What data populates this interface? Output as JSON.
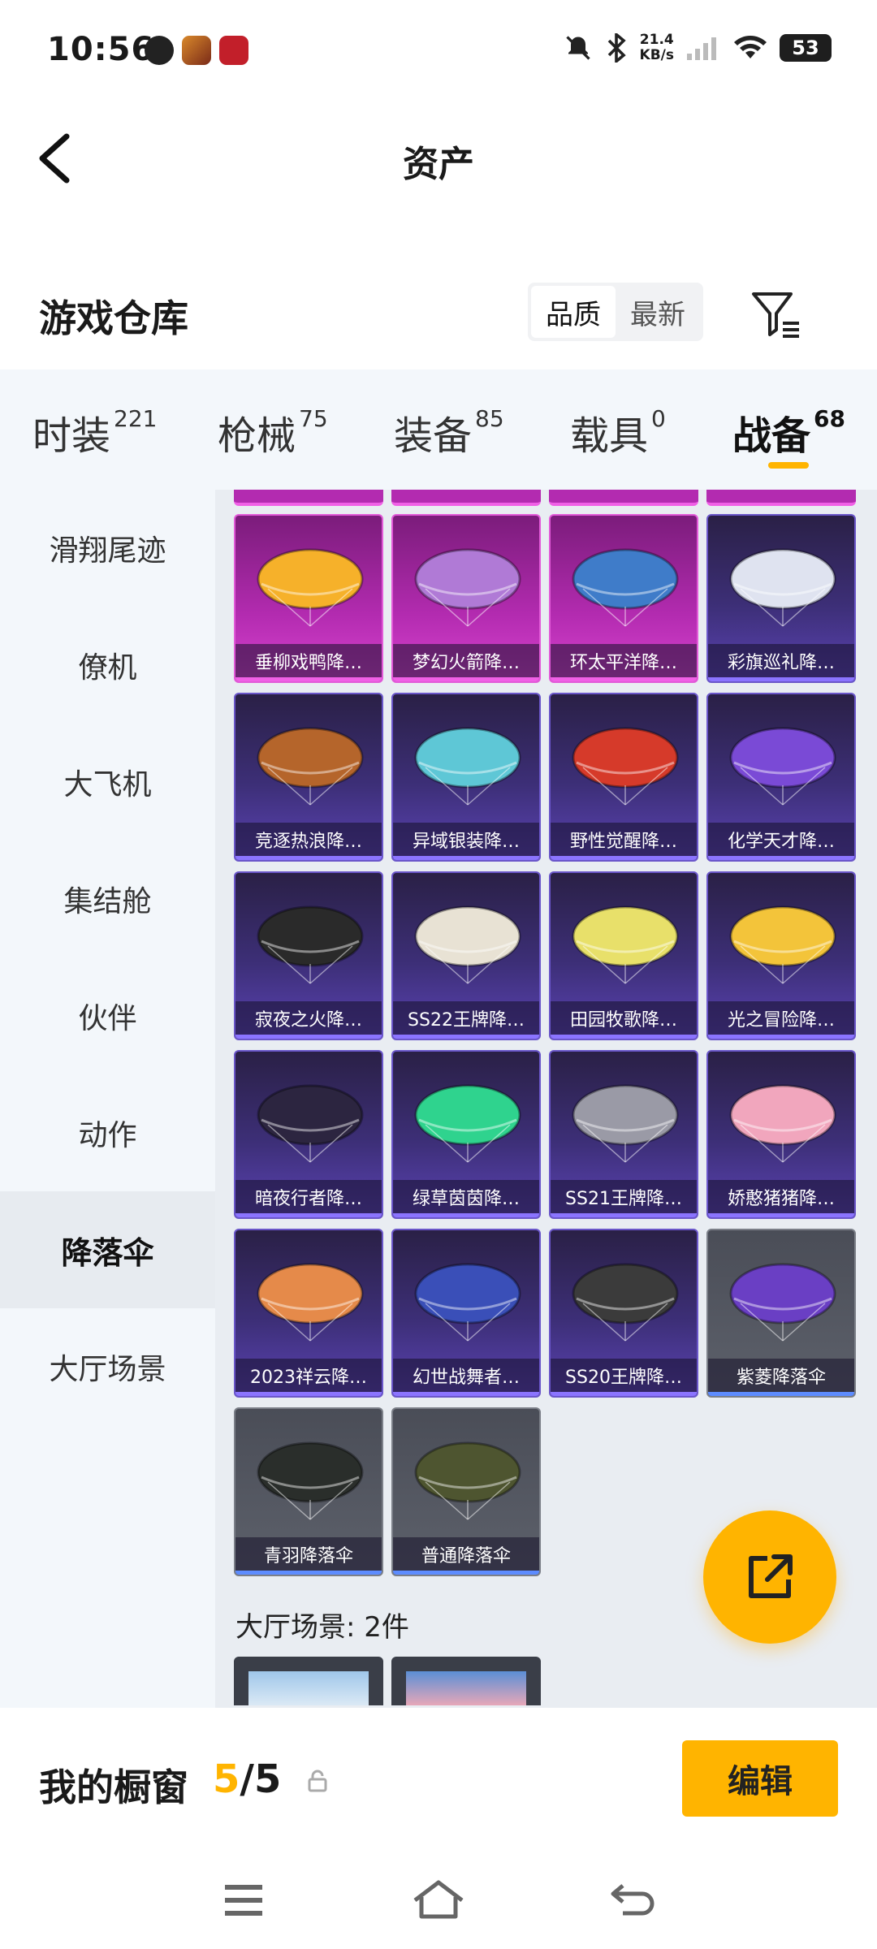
{
  "status_bar": {
    "time": "10:56",
    "net_speed_value": "21.4",
    "net_speed_unit": "KB/s",
    "battery": "53"
  },
  "header": {
    "title": "资产"
  },
  "section": {
    "title": "游戏仓库",
    "sort_options": [
      "品质",
      "最新"
    ],
    "active_sort": "品质"
  },
  "category_tabs": [
    {
      "label": "时装",
      "count": "221"
    },
    {
      "label": "枪械",
      "count": "75"
    },
    {
      "label": "装备",
      "count": "85"
    },
    {
      "label": "载具",
      "count": "0"
    },
    {
      "label": "战备",
      "count": "68",
      "active": true
    }
  ],
  "side_menu": [
    {
      "label": "滑翔尾迹"
    },
    {
      "label": "僚机"
    },
    {
      "label": "大飞机"
    },
    {
      "label": "集结舱"
    },
    {
      "label": "伙伴"
    },
    {
      "label": "动作"
    },
    {
      "label": "降落伞",
      "active": true
    },
    {
      "label": "大厅场景"
    }
  ],
  "items": [
    {
      "name": "垂柳戏鸭降…",
      "rarity": "pink",
      "color": "#f6b12a"
    },
    {
      "name": "梦幻火箭降…",
      "rarity": "pink",
      "color": "#b07ad6"
    },
    {
      "name": "环太平洋降…",
      "rarity": "pink",
      "color": "#3f7cc9"
    },
    {
      "name": "彩旗巡礼降…",
      "rarity": "purple",
      "color": "#dfe3f0"
    },
    {
      "name": "竞逐热浪降…",
      "rarity": "purple",
      "color": "#b5652b"
    },
    {
      "name": "异域银装降…",
      "rarity": "purple",
      "color": "#5ec7d6"
    },
    {
      "name": "野性觉醒降…",
      "rarity": "purple",
      "color": "#d63a2a"
    },
    {
      "name": "化学天才降…",
      "rarity": "purple",
      "color": "#7a4ad6"
    },
    {
      "name": "寂夜之火降…",
      "rarity": "purple",
      "color": "#2a2a2a"
    },
    {
      "name": "SS22王牌降…",
      "rarity": "purple",
      "color": "#e8e2d4"
    },
    {
      "name": "田园牧歌降…",
      "rarity": "purple",
      "color": "#e8e06a"
    },
    {
      "name": "光之冒险降…",
      "rarity": "purple",
      "color": "#f3c43a"
    },
    {
      "name": "暗夜行者降…",
      "rarity": "purple",
      "color": "#2c2540"
    },
    {
      "name": "绿草茵茵降…",
      "rarity": "purple",
      "color": "#2fd38e"
    },
    {
      "name": "SS21王牌降…",
      "rarity": "purple",
      "color": "#9a9aa6"
    },
    {
      "name": "娇憨猪猪降…",
      "rarity": "purple",
      "color": "#f1a6bd"
    },
    {
      "name": "2023祥云降…",
      "rarity": "purple",
      "color": "#e58a4a"
    },
    {
      "name": "幻世战舞者…",
      "rarity": "purple",
      "color": "#3a4fb8"
    },
    {
      "name": "SS20王牌降…",
      "rarity": "purple",
      "color": "#3b3b3b"
    },
    {
      "name": "紫菱降落伞",
      "rarity": "gray",
      "color": "#6a3fc4"
    },
    {
      "name": "青羽降落伞",
      "rarity": "gray",
      "color": "#2a2e2b"
    },
    {
      "name": "普通降落伞",
      "rarity": "gray",
      "color": "#4e5530"
    }
  ],
  "hall_scene": {
    "label": "大厅场景: 2件"
  },
  "showcase": {
    "label": "我的橱窗",
    "current": "5",
    "separator": "/",
    "total": "5",
    "edit_label": "编辑"
  }
}
